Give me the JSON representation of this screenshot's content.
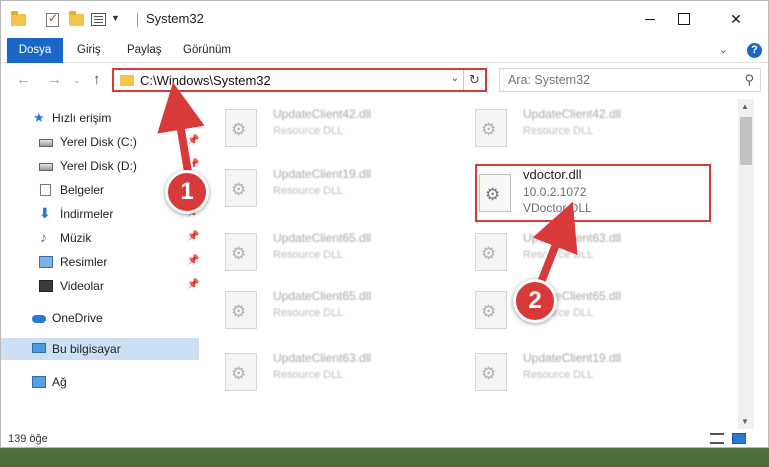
{
  "window": {
    "title": "System32",
    "controls": {
      "minimize": "",
      "maximize": "",
      "close": "✕"
    }
  },
  "ribbon": {
    "tabs": [
      {
        "label": "Dosya"
      },
      {
        "label": "Giriş"
      },
      {
        "label": "Paylaş"
      },
      {
        "label": "Görünüm"
      }
    ],
    "help": "?"
  },
  "address": {
    "path": "C:\\Windows\\System32"
  },
  "search": {
    "placeholder": "Ara: System32"
  },
  "sidebar": {
    "quick_access": "Hızlı erişim",
    "items": [
      {
        "label": "Yerel Disk (C:)",
        "icon": "drive-icon"
      },
      {
        "label": "Yerel Disk (D:)",
        "icon": "drive-icon"
      },
      {
        "label": "Belgeler",
        "icon": "document-icon"
      },
      {
        "label": "İndirmeler",
        "icon": "download-icon"
      },
      {
        "label": "Müzik",
        "icon": "music-icon"
      },
      {
        "label": "Resimler",
        "icon": "pictures-icon"
      },
      {
        "label": "Videolar",
        "icon": "videos-icon"
      }
    ],
    "onedrive": "OneDrive",
    "this_pc": "Bu bilgisayar",
    "network": "Ağ"
  },
  "files": [
    {
      "name": "UpdateClient42.dll",
      "type": "Resource DLL"
    },
    {
      "name": "UpdateClient42.dll",
      "type": "Resource DLL"
    },
    {
      "name": "UpdateClient19.dll",
      "type": "Resource DLL"
    },
    {
      "name": "UpdateClient65.dll",
      "type": "Resource DLL"
    },
    {
      "name": "UpdateClient63.dll",
      "type": "Resource DLL"
    },
    {
      "name": "UpdateClient65.dll",
      "type": "Resource DLL"
    },
    {
      "name": "UpdateClient65.dll",
      "type": "Resource DLL"
    },
    {
      "name": "UpdateClient63.dll",
      "type": "Resource DLL"
    },
    {
      "name": "UpdateClient19.dll",
      "type": "Resource DLL"
    }
  ],
  "target_file": {
    "name": "vdoctor.dll",
    "version": "10.0.2.1072",
    "type": "VDoctor DLL"
  },
  "status": {
    "count": "139 öğe"
  },
  "annotations": {
    "step1": "1",
    "step2": "2"
  },
  "colors": {
    "accent": "#1a67c7",
    "highlight": "#d83a3a",
    "selection": "#cce0f5"
  }
}
